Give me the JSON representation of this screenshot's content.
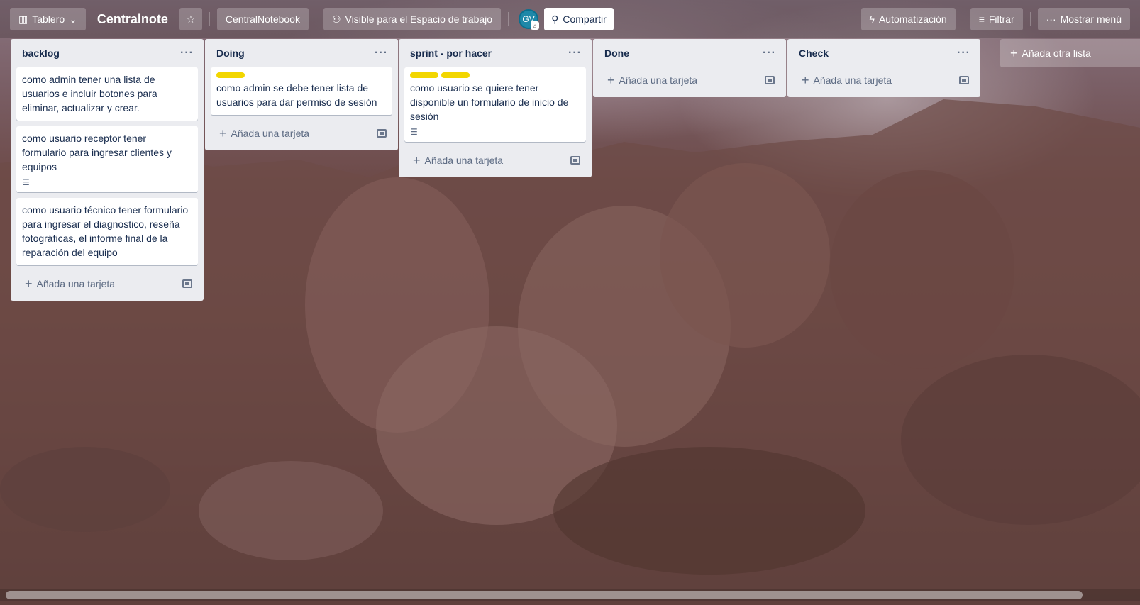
{
  "header": {
    "view_label": "Tablero",
    "board_name": "Centralnote",
    "workspace": "CentralNotebook",
    "visibility": "Visible para el Espacio de trabajo",
    "avatar_initials": "GV",
    "share": "Compartir",
    "automation": "Automatización",
    "filter": "Filtrar",
    "menu": "Mostrar menú"
  },
  "lists": [
    {
      "title": "backlog",
      "cards": [
        {
          "text": "como admin tener una lista de usuarios e incluir botones para eliminar, actualizar y crear."
        },
        {
          "text": "como usuario receptor tener formulario para ingresar clientes y equipos",
          "has_description": true
        },
        {
          "text": "como usuario técnico tener formulario para ingresar el diagnostico, reseña fotográficas, el informe final de la reparación del equipo"
        }
      ],
      "add_card": "Añada una tarjeta"
    },
    {
      "title": "Doing",
      "cards": [
        {
          "text": "como admin se debe tener lista de usuarios para dar permiso de sesión",
          "labels": [
            "#f2d600"
          ]
        }
      ],
      "add_card": "Añada una tarjeta"
    },
    {
      "title": "sprint - por hacer",
      "cards": [
        {
          "text": "como usuario se quiere tener disponible un formulario de inicio de sesión",
          "labels": [
            "#f2d600",
            "#f2d600"
          ],
          "has_description": true
        }
      ],
      "add_card": "Añada una tarjeta"
    },
    {
      "title": "Done",
      "cards": [],
      "add_card": "Añada una tarjeta"
    },
    {
      "title": "Check",
      "cards": [],
      "add_card": "Añada una tarjeta"
    }
  ],
  "add_list": "Añada otra lista",
  "icons": {
    "board": "board-icon",
    "chevron": "chevron-down-icon",
    "star": "star-icon",
    "visibility": "people-icon",
    "share": "add-person-icon",
    "automation": "lightning-icon",
    "filter": "filter-icon",
    "menu": "more-icon",
    "list_menu": "more-icon",
    "description": "description-icon",
    "template": "template-icon",
    "plus": "plus-icon"
  },
  "colors": {
    "label_yellow": "#f2d600",
    "list_bg": "#ebecf0",
    "avatar_bg": "#1e88a8"
  }
}
